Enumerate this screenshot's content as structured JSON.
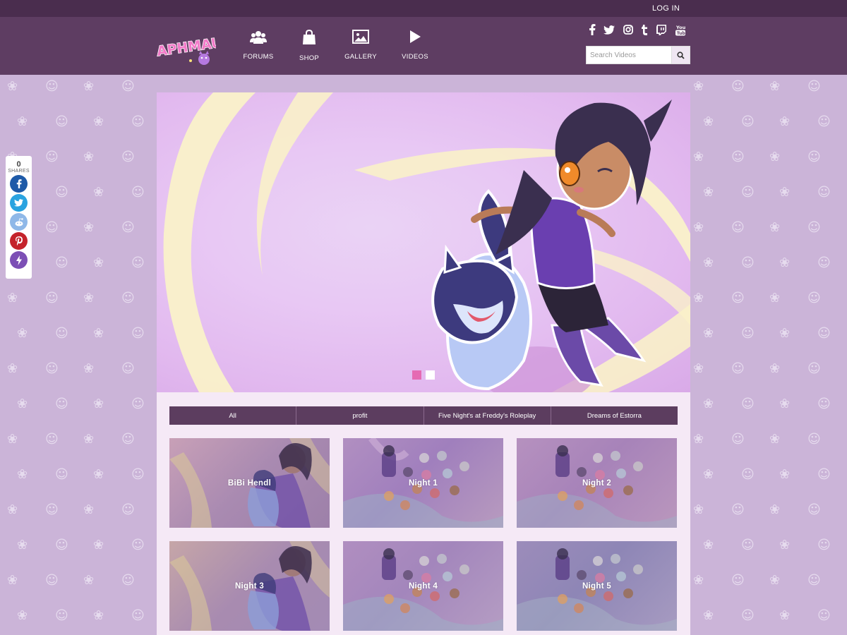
{
  "topbar": {
    "login_label": "LOG IN"
  },
  "logo": {
    "text": "APHMAU"
  },
  "nav": [
    {
      "label": "FORUMS",
      "icon": "users-icon"
    },
    {
      "label": "SHOP",
      "icon": "shopping-bag-icon"
    },
    {
      "label": "GALLERY",
      "icon": "image-icon"
    },
    {
      "label": "VIDEOS",
      "icon": "play-icon"
    }
  ],
  "social": [
    "facebook-icon",
    "twitter-icon",
    "instagram-icon",
    "tumblr-icon",
    "twitch-icon",
    "youtube-icon"
  ],
  "search": {
    "placeholder": "Search Videos"
  },
  "share": {
    "count": "0",
    "label": "SHARES",
    "buttons": [
      {
        "name": "facebook",
        "color": "#1e5aa8"
      },
      {
        "name": "twitter",
        "color": "#2aa3e0"
      },
      {
        "name": "reddit",
        "color": "#8fb8e8"
      },
      {
        "name": "pinterest",
        "color": "#c4232b"
      },
      {
        "name": "lightning",
        "color": "#7c4fb5"
      }
    ]
  },
  "tabs": [
    "All",
    "profit",
    "Five Night's at Freddy's Roleplay",
    "Dreams of Estorra"
  ],
  "videos": [
    {
      "title": "BiBi Hendl"
    },
    {
      "title": "Night 1"
    },
    {
      "title": "Night 2"
    },
    {
      "title": "Night 3"
    },
    {
      "title": "Night 4"
    },
    {
      "title": "Night 5"
    }
  ],
  "colors": {
    "topbar": "#4a2d4e",
    "header": "#5e3d62",
    "background": "#cbb4d8",
    "content": "#f5e9f6",
    "tabs": "#5c3d5f",
    "accent": "#e56bb3"
  }
}
